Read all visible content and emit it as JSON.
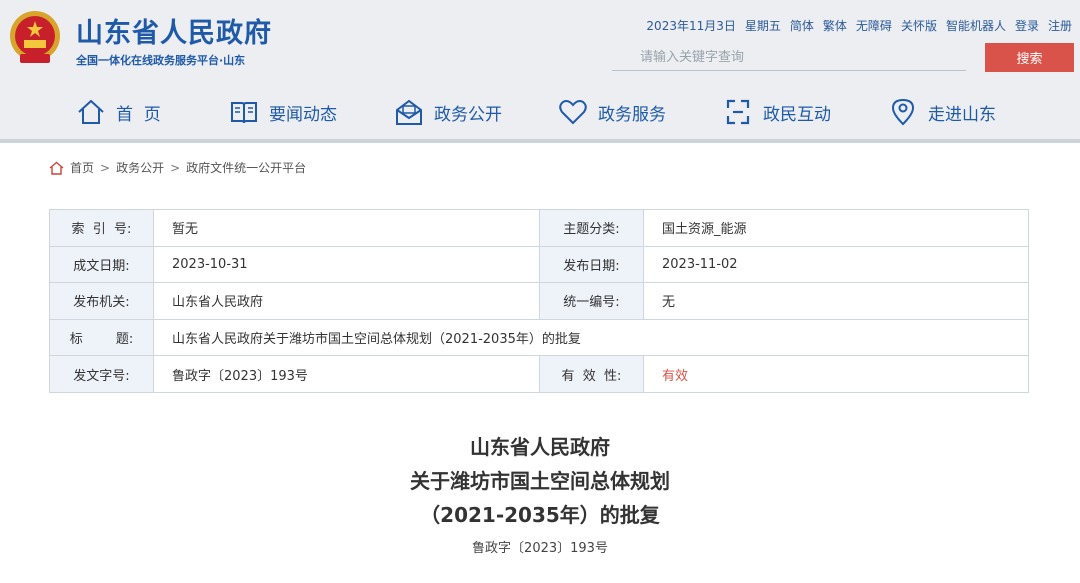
{
  "header": {
    "site_name": "山东省人民政府",
    "site_subtitle": "全国一体化在线政务服务平台·山东",
    "date": "2023年11月3日",
    "weekday": "星期五",
    "links": [
      "简体",
      "繁体",
      "无障碍",
      "关怀版",
      "智能机器人",
      "登录",
      "注册"
    ],
    "search_placeholder": "请输入关键字查询",
    "search_button": "搜索"
  },
  "nav": [
    {
      "label": "首  页",
      "icon": "home-icon"
    },
    {
      "label": "要闻动态",
      "icon": "book-icon"
    },
    {
      "label": "政务公开",
      "icon": "mail-open-icon"
    },
    {
      "label": "政务服务",
      "icon": "heart-icon"
    },
    {
      "label": "政民互动",
      "icon": "link-icon"
    },
    {
      "label": "走进山东",
      "icon": "location-pin-icon"
    }
  ],
  "breadcrumb": [
    "首页",
    "政务公开",
    "政府文件统一公开平台"
  ],
  "info": {
    "index_label": "索  引  号:",
    "index_value": "暂无",
    "category_label": "主题分类:",
    "category_value": "国土资源_能源",
    "written_label": "成文日期:",
    "written_value": "2023-10-31",
    "published_label": "发布日期:",
    "published_value": "2023-11-02",
    "issuer_label": "发布机关:",
    "issuer_value": "山东省人民政府",
    "code_label": "统一编号:",
    "code_value": "无",
    "title_label": "标        题:",
    "title_value": "山东省人民政府关于潍坊市国土空间总体规划（2021-2035年）的批复",
    "docno_label": "发文字号:",
    "docno_value": "鲁政字〔2023〕193号",
    "validity_label": "有  效  性:",
    "validity_value": "有效"
  },
  "document": {
    "title_line1": "山东省人民政府",
    "title_line2": "关于潍坊市国土空间总体规划",
    "title_line3": "（2021-2035年）的批复",
    "doc_number": "鲁政字〔2023〕193号"
  },
  "colors": {
    "brand": "#1f5aa8",
    "accent": "#d9534a",
    "header_bg": "#eceef1"
  }
}
